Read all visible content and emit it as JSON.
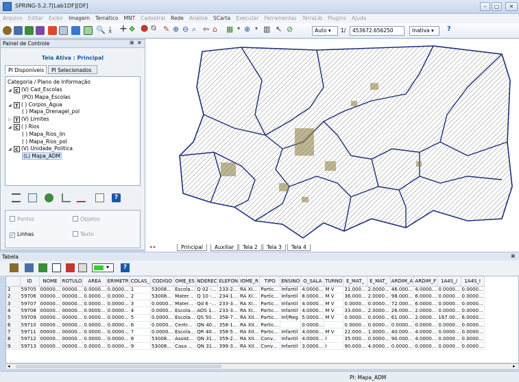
{
  "window": {
    "title": "SPRING-5.2.7[Lab1DF][DF]",
    "min": "–",
    "max": "▢",
    "close": "✕"
  },
  "menu": [
    {
      "label": "Arquivo",
      "dim": true
    },
    {
      "label": "Editar",
      "dim": true
    },
    {
      "label": "Exibir",
      "dim": true
    },
    {
      "label": "Imagem",
      "dim": false
    },
    {
      "label": "Temático",
      "dim": false
    },
    {
      "label": "MNT",
      "dim": false
    },
    {
      "label": "Cadastral",
      "dim": true
    },
    {
      "label": "Rede",
      "dim": false
    },
    {
      "label": "Análise",
      "dim": true
    },
    {
      "label": "SCarta",
      "dim": false
    },
    {
      "label": "Executar",
      "dim": true
    },
    {
      "label": "Ferramentas",
      "dim": true
    },
    {
      "label": "TerraLib",
      "dim": true
    },
    {
      "label": "Plugins",
      "dim": true
    },
    {
      "label": "Ajuda",
      "dim": true
    }
  ],
  "toolbar": {
    "zoom_mode": "Auto",
    "page": "1/",
    "scale": "453672.656250",
    "state": "Inativa",
    "help": "?"
  },
  "control_panel": {
    "title": "Painel de Controle",
    "close": "✕",
    "active_screen": "Tela Ativa : Principal",
    "tabs": [
      "PI Disponíveis",
      "PI Selecionados"
    ],
    "tree_header": "Categoria / Plano de Informação",
    "tree": [
      {
        "type": "cat",
        "letter": "C",
        "label": "(V) Cad_Escolas",
        "expanded": true
      },
      {
        "type": "pi",
        "label": "(PO) Mapa_Escolas"
      },
      {
        "type": "cat",
        "letter": "T",
        "label": "( ) Corpos_Agua",
        "expanded": true
      },
      {
        "type": "pi",
        "label": "( ) Mapa_Drenagel_pol"
      },
      {
        "type": "cat",
        "letter": "T",
        "label": "(V) Limites",
        "expanded": false
      },
      {
        "type": "cat",
        "letter": "C",
        "label": "( ) Rios",
        "expanded": true
      },
      {
        "type": "pi",
        "label": "( ) Mapa_Rios_lin"
      },
      {
        "type": "pi",
        "label": "( ) Mapa_Rios_pol"
      },
      {
        "type": "cat",
        "letter": "C",
        "label": "(V) Unidade_Politica",
        "expanded": true
      },
      {
        "type": "pi",
        "label": "(L) Mapa_ADM",
        "selected": true
      }
    ],
    "options": {
      "pontos": "Pontos",
      "objetos": "Objetos",
      "linhas": "Linhas",
      "texto": "Texto",
      "linhas_checked": true
    }
  },
  "map_tabs": [
    "Principal",
    "Auxiliar",
    "Tela 2",
    "Tela 3",
    "Tela 4"
  ],
  "table_panel": {
    "title": "Tabela",
    "columns": [
      "ID",
      "NOME",
      "ROTULO",
      "AREA",
      "ERIMETR",
      "COLAS_",
      "CODIGO",
      "OME_ES",
      "NDEREC",
      "ELEFON",
      "IOME_R",
      "TIPO",
      "ENSINO",
      "O_SALA",
      "TURNO",
      "E_MAT_",
      "E_MAT_",
      "ARDIM_A",
      "ARDIM_F",
      "1A4S_/",
      "1A4S_I"
    ],
    "rows": [
      [
        "1",
        "59705",
        "00000...",
        "00000...",
        "0.0000...",
        "0.0000...",
        "1",
        "53008...",
        "Escola...",
        "Q 02 -...",
        "233-2...",
        "RA XI...",
        "Partic...",
        "Infantil",
        "4.0000...",
        "M V",
        "31.000...",
        "2.0000...",
        "46.000...",
        "4.0000...",
        "0.0000...",
        "0.0000..."
      ],
      [
        "2",
        "59706",
        "00000...",
        "00000...",
        "0.0000...",
        "0.0000...",
        "2",
        "53008...",
        "Mater...",
        "Q 10 -...",
        "234-1...",
        "RA XI...",
        "Partic...",
        "Infantil",
        "8.0000...",
        "M V",
        "36.000...",
        "2.0000...",
        "98.000...",
        "6.0000...",
        "0.0000...",
        "0.0000..."
      ],
      [
        "3",
        "59707",
        "00000...",
        "00000...",
        "0.0000...",
        "0.0000...",
        "3",
        "0.0000...",
        "Mater...",
        "Qd 6 -...",
        "233-3...",
        "RA XI...",
        "Partic...",
        "Infantil",
        "4.0000...",
        "M V",
        "0.0000...",
        "0.0000...",
        "72.000...",
        "6.0000...",
        "0.0000...",
        "0.0000..."
      ],
      [
        "4",
        "59708",
        "00000...",
        "00000...",
        "0.0000...",
        "0.0000...",
        "4",
        "0.0000...",
        "Escola...",
        "AOS 1...",
        "233-3...",
        "RA XI...",
        "Partic...",
        "Infantil",
        "4.0000...",
        "M V",
        "33.000...",
        "2.0000...",
        "26.000...",
        "2.0000...",
        "0.0000...",
        "0.0000..."
      ],
      [
        "5",
        "59709",
        "00000...",
        "00000...",
        "0.0000...",
        "0.0000...",
        "5",
        "0.0000...",
        "Escola...",
        "QS 50...",
        "358-7...",
        "RA XII...",
        "Partic...",
        "Inf/Reg",
        "5.0000...",
        "M V",
        "0.0000...",
        "0.0000...",
        "61.000...",
        "2.0000...",
        "167.00...",
        "6.0000..."
      ],
      [
        "6",
        "59710",
        "00000...",
        "00000...",
        "0.0000...",
        "0.0000...",
        "6",
        "0.0000...",
        "Centr...",
        "QN 40...",
        "358-1...",
        "RA XII...",
        "Partic...",
        "",
        "0.0000...",
        "",
        "0.0000...",
        "0.0000...",
        "0.0000...",
        "0.0000...",
        "0.0000...",
        "0.0000..."
      ],
      [
        "7",
        "59711",
        "00000...",
        "00000...",
        "0.0000...",
        "0.0000...",
        "7",
        "0.0000...",
        "Escola...",
        "QR 40...",
        "358-5...",
        "RA XII...",
        "Partic...",
        "Infantil",
        "4.0000...",
        "M V",
        "22.000...",
        "1.0000...",
        "40.000...",
        "4.0000...",
        "0.0000...",
        "0.0000..."
      ],
      [
        "8",
        "59712",
        "00000...",
        "00000...",
        "0.0000...",
        "0.0000...",
        "8",
        "53008...",
        "Assist...",
        "QN 31...",
        "359-2...",
        "RA XII...",
        "Conv...",
        "Infantil",
        "4.0000...",
        "I",
        "35.000...",
        "0.0000...",
        "90.000...",
        "4.0000...",
        "0.0000...",
        "0.0000..."
      ],
      [
        "9",
        "59713",
        "00000...",
        "00000...",
        "0.0000...",
        "0.0000...",
        "9",
        "53008...",
        "Casa ...",
        "QN 31...",
        "399-3...",
        "RA XII...",
        "Conv...",
        "Infantil",
        "3.0000...",
        "I",
        "90.000...",
        "4.0000...",
        "0.0000...",
        "0.0000...",
        "0.0000...",
        "0.0000..."
      ]
    ]
  },
  "status": {
    "pi": "PI: Mapa_ADM"
  }
}
